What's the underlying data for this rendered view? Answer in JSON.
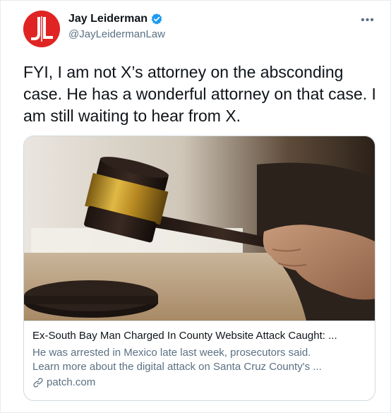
{
  "author": {
    "display_name": "Jay Leiderman",
    "handle": "@JayLeidermanLaw",
    "avatar_initials": "JL",
    "avatar_color": "#e02424",
    "verified": true,
    "verified_icon": "verified-badge-icon",
    "verified_color": "#1d9bf0"
  },
  "menu": {
    "more_label": "•••"
  },
  "tweet": {
    "text": "FYI, I am not X’s attorney on the absconding case. He has a wonderful attorney on that case. I am still waiting to hear from X."
  },
  "card": {
    "image_subject": "gavel",
    "title": "Ex-South Bay Man Charged In County Website Attack Caught: ...",
    "description_line1": "He was arrested in Mexico late last week, prosecutors said.",
    "description_line2": "Learn more about the digital attack on Santa Cruz County's ...",
    "domain": "patch.com",
    "domain_icon": "link-icon"
  }
}
